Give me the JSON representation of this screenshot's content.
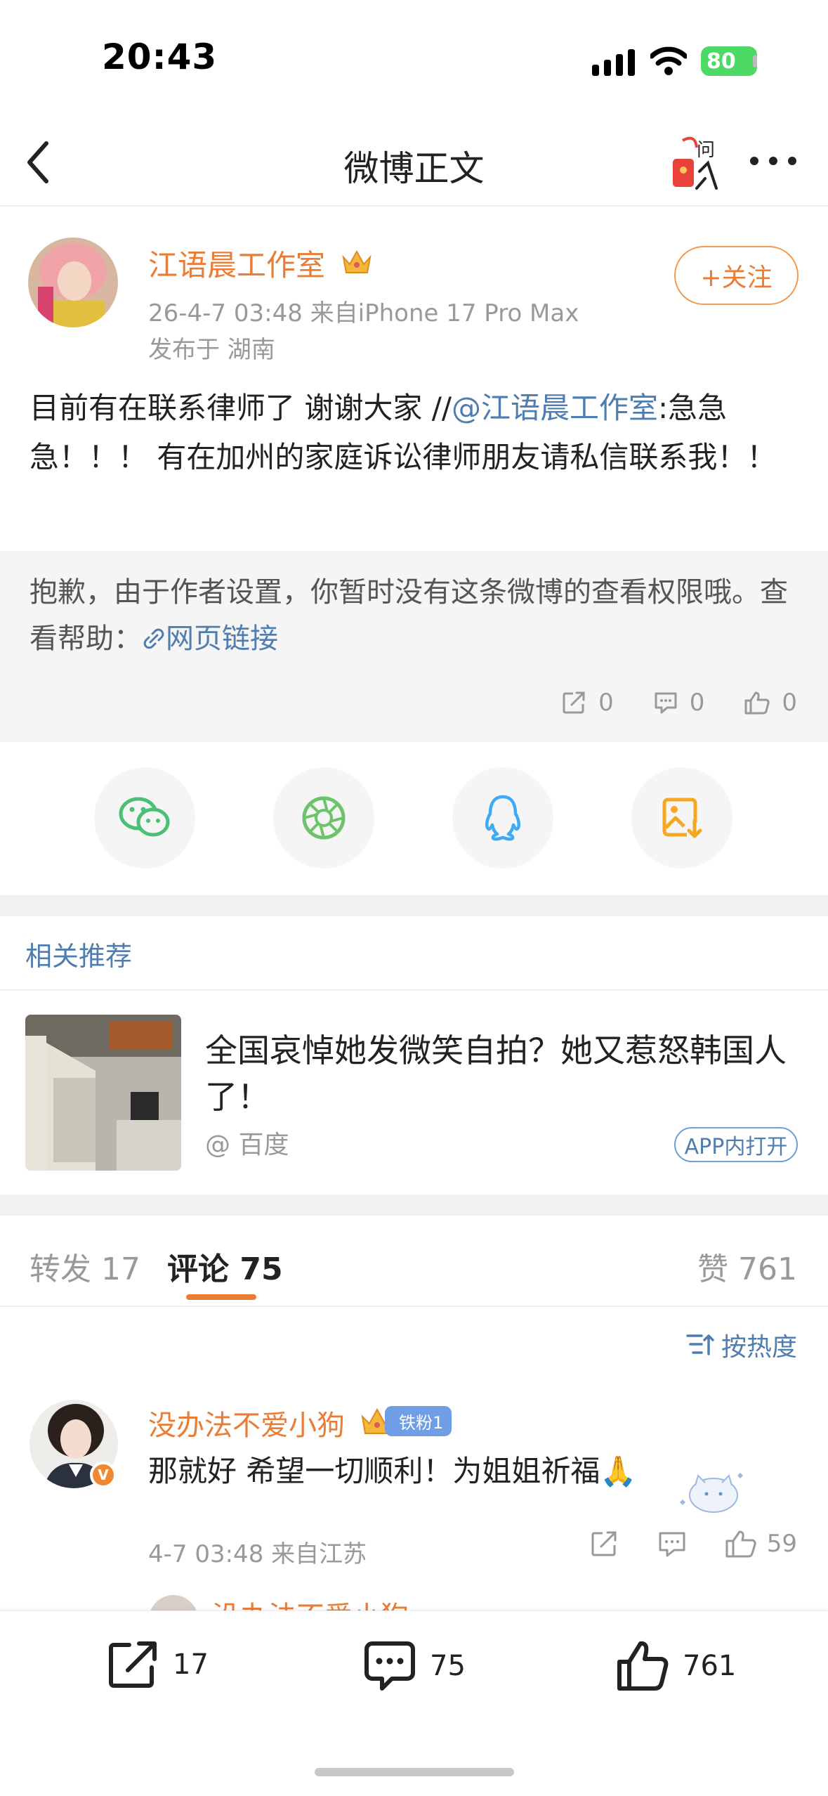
{
  "status_bar": {
    "time": "20:43",
    "battery": "80"
  },
  "nav": {
    "title": "微博正文",
    "ask_label": "问"
  },
  "post": {
    "author": "江语晨工作室",
    "meta": "26-4-7 03:48  来自iPhone 17 Pro Max",
    "location": "发布于 湖南",
    "follow_label": "+关注",
    "text_part1": "目前有在联系律师了 谢谢大家 //",
    "mention": "@江语晨工作室",
    "text_part2": ":急急急！！！ 有在加州的家庭诉讼律师朋友请私信联系我！！"
  },
  "retweet": {
    "text": "抱歉，由于作者设置，你暂时没有这条微博的查看权限哦。查看帮助：",
    "link_label": "网页链接",
    "reposts": "0",
    "comments": "0",
    "likes": "0"
  },
  "share": {
    "icons": [
      "wechat-icon",
      "moments-icon",
      "qq-icon",
      "save-image-icon"
    ]
  },
  "related": {
    "section_title": "相关推荐",
    "headline": "全国哀悼她发微笑自拍？她又惹怒韩国人了！",
    "source": "@ 百度",
    "open_label": "APP内打开"
  },
  "tabs": {
    "repost_label": "转发",
    "repost_count": "17",
    "comment_label": "评论",
    "comment_count": "75",
    "like_label": "赞",
    "like_count": "761"
  },
  "sort": {
    "label": "按热度"
  },
  "comment": {
    "author": "没办法不爱小狗",
    "badge": "铁粉1",
    "text": "那就好 希望一切顺利！为姐姐祈福🙏",
    "meta": "4-7 03:48  来自江苏",
    "likes": "59"
  },
  "peek_comment": {
    "author": "没办法不爱小狗"
  },
  "toolbar": {
    "reposts": "17",
    "comments": "75",
    "likes": "761"
  },
  "colors": {
    "accent": "#ea7d35",
    "link": "#507daf",
    "battery": "#4cd964"
  }
}
